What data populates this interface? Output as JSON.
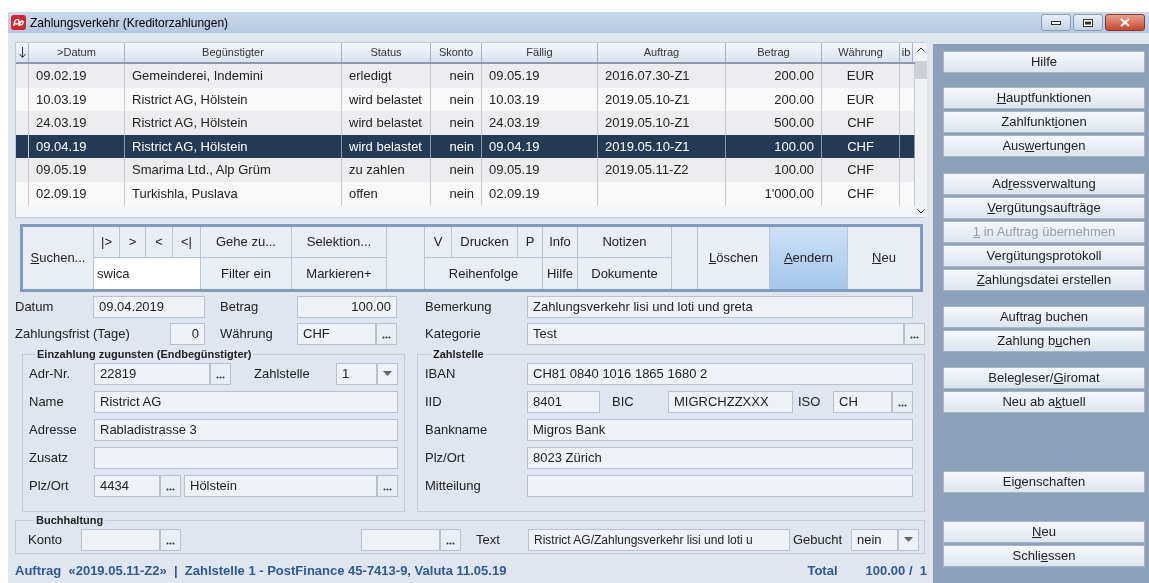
{
  "window": {
    "title": "Zahlungsverkehr (Kreditorzahlungen)"
  },
  "table": {
    "columns": [
      ">Datum",
      "Begünstigter",
      "Status",
      "Skonto",
      "Fällig",
      "Auftrag",
      "Betrag",
      "Währung",
      "ib"
    ],
    "rows": [
      {
        "cells": [
          "09.02.19",
          "Gemeinderei, Indemini",
          "erledigt",
          "nein",
          "09.05.19",
          "2016.07.30-Z1",
          "200.00",
          "EUR"
        ],
        "selected": false
      },
      {
        "cells": [
          "10.03.19",
          "Ristrict AG, Hölstein",
          "wird belastet",
          "nein",
          "10.03.19",
          "2019.05.10-Z1",
          "200.00",
          "EUR"
        ],
        "selected": false
      },
      {
        "cells": [
          "24.03.19",
          "Ristrict AG, Hölstein",
          "wird belastet",
          "nein",
          "24.03.19",
          "2019.05.10-Z1",
          "500.00",
          "CHF"
        ],
        "selected": false
      },
      {
        "cells": [
          "09.04.19",
          "Ristrict AG, Hölstein",
          "wird belastet",
          "nein",
          "09.04.19",
          "2019.05.10-Z1",
          "100.00",
          "CHF"
        ],
        "selected": true
      },
      {
        "cells": [
          "09.05.19",
          "Smarima Ltd., Alp Grüm",
          "zu zahlen",
          "nein",
          "09.05.19",
          "2019.05.11-Z2",
          "100.00",
          "CHF"
        ],
        "selected": false
      },
      {
        "cells": [
          "02.09.19",
          "Turkishla, Puslava",
          "offen",
          "nein",
          "02.09.19",
          null,
          "1'000.00",
          "CHF"
        ],
        "selected": false
      }
    ]
  },
  "toolbar": {
    "search_button": {
      "key": "S",
      "post": "uchen..."
    },
    "nav_buttons": [
      "|>",
      ">",
      "<",
      "<|"
    ],
    "search_field": {
      "value": "swica"
    },
    "buttons": [
      "Gehe zu...",
      "Selektion...",
      "V",
      "Drucken",
      "P",
      "Info",
      "Notizen",
      "Filter ein",
      "Markieren+",
      "Reihenfolge",
      "Hilfe",
      "Dokumente"
    ],
    "actions": [
      {
        "key": "L",
        "post": "öschen",
        "selected": false
      },
      {
        "key": "A",
        "post": "endern",
        "selected": true
      },
      {
        "key": "N",
        "post": "eu",
        "selected": false
      }
    ]
  },
  "form": {
    "datum": {
      "label": "Datum",
      "value": "09.04.2019"
    },
    "betrag": {
      "label": "Betrag",
      "value": "100.00"
    },
    "bemerkung": {
      "label": "Bemerkung",
      "value": "Zahlungsverkehr lisi und loti und greta"
    },
    "zahlungsfrist": {
      "label": "Zahlungsfrist (Tage)",
      "value": "0"
    },
    "waehrung": {
      "label": "Währung",
      "value": "CHF",
      "kind": "browse"
    },
    "kategorie": {
      "label": "Kategorie",
      "value": "Test",
      "kind": "browse"
    }
  },
  "beneficiary": {
    "title": "Einzahlung zugunsten (Endbegünstigter)",
    "adr_nr": {
      "label": "Adr-Nr.",
      "value": "22819",
      "kind": "browse"
    },
    "zahlstelle": {
      "label": "Zahlstelle",
      "value": "1",
      "kind": "combo"
    },
    "name": {
      "label": "Name",
      "value": "Ristrict AG"
    },
    "adresse": {
      "label": "Adresse",
      "value": "Rabladistrasse 3"
    },
    "zusatz": {
      "label": "Zusatz"
    },
    "plz": {
      "label": "Plz/Ort",
      "value": "4434",
      "kind": "browse"
    },
    "ort": {
      "value": "Hölstein",
      "kind": "browse"
    }
  },
  "payment_office": {
    "title": "Zahlstelle",
    "iban": {
      "label": "IBAN",
      "value": "CH81 0840 1016 1865 1680 2"
    },
    "iid": {
      "label": "IID",
      "value": "8401"
    },
    "bic": {
      "label": "BIC",
      "value": "MIGRCHZZXXX"
    },
    "iso": {
      "label": "ISO",
      "value": "CH",
      "kind": "browse"
    },
    "bankname": {
      "label": "Bankname",
      "value": "Migros Bank"
    },
    "plz_ort": {
      "label": "Plz/Ort",
      "value": "8023 Zürich"
    },
    "mitteilung": {
      "label": "Mitteilung"
    }
  },
  "accounting": {
    "title": "Buchhaltung",
    "konto": {
      "label": "Konto",
      "kind": "browse"
    },
    "field_2": {
      "kind": "browse"
    },
    "text": {
      "label": "Text",
      "value": "Ristrict AG/Zahlungsverkehr lisi und loti u"
    },
    "gebucht": {
      "label": "Gebucht",
      "value": "nein",
      "kind": "combo"
    }
  },
  "status_bar": {
    "info": "Auftrag  «2019.05.11-Z2»  |  Zahlstelle 1 - PostFinance 45-7413-9, Valuta 11.05.19",
    "total_label": "Total",
    "total": "100.00 /  1"
  },
  "side_panel": {
    "groups": [
      [
        {
          "pre": "Hilfe",
          "disabled": false
        }
      ],
      [
        {
          "key": "H",
          "post": "auptfunktionen",
          "disabled": false
        },
        {
          "pre": "Zahlfunkt",
          "key": "i",
          "post": "onen",
          "disabled": false
        },
        {
          "pre": "Aus",
          "key": "w",
          "post": "ertungen",
          "disabled": false
        }
      ],
      [
        {
          "pre": "Ad",
          "key": "r",
          "post": "essverwaltung",
          "disabled": false
        },
        {
          "key": "V",
          "post": "ergütungsaufträge",
          "disabled": false
        },
        {
          "key": "1",
          "post": " in Auftrag übernehmen",
          "disabled": true
        },
        {
          "pre": "Vergütungsprotokoll",
          "disabled": false
        },
        {
          "key": "Z",
          "post": "ahlungsdatei erstellen",
          "disabled": false
        }
      ],
      [
        {
          "pre": "Auftra",
          "key": "g",
          "post": " buchen",
          "disabled": false
        },
        {
          "pre": "Zahlung b",
          "key": "u",
          "post": "chen",
          "disabled": false
        }
      ],
      [
        {
          "pre": "Belegleser/",
          "key": "G",
          "post": "iromat",
          "disabled": false
        },
        {
          "pre": "Neu ab a",
          "key": "k",
          "post": "tuell",
          "disabled": false
        }
      ],
      [
        {
          "pre": "Ei",
          "key": "g",
          "post": "enschaften",
          "disabled": false
        }
      ],
      [
        {
          "key": "N",
          "post": "eu",
          "disabled": false
        },
        {
          "pre": "Schli",
          "key": "e",
          "post": "ssen",
          "disabled": false
        }
      ]
    ]
  }
}
